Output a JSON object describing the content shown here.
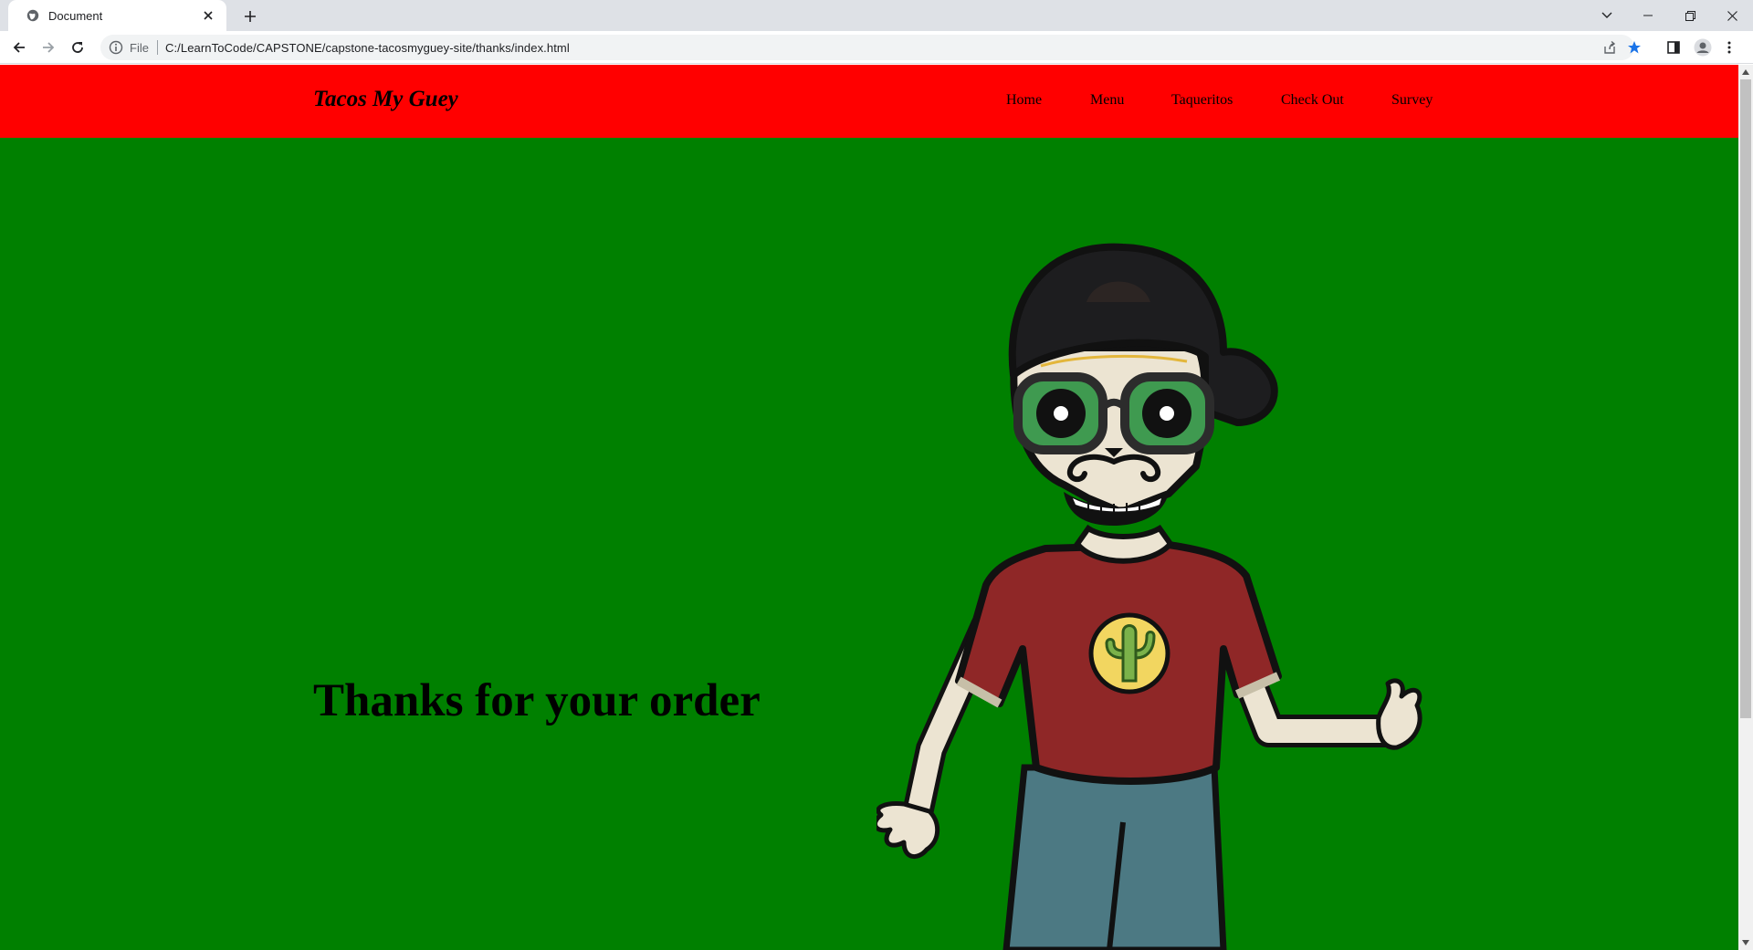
{
  "browser": {
    "tab_title": "Document",
    "address_scheme": "File",
    "address_url": "C:/LearnToCode/CAPSTONE/capstone-tacosmyguey-site/thanks/index.html"
  },
  "site": {
    "brand": "Tacos My Guey",
    "nav": [
      "Home",
      "Menu",
      "Taqueritos",
      "Check Out",
      "Survey"
    ],
    "heading": "Thanks for your order"
  },
  "colors": {
    "header_bg": "#ff0000",
    "page_bg": "#008000",
    "text": "#000000"
  }
}
